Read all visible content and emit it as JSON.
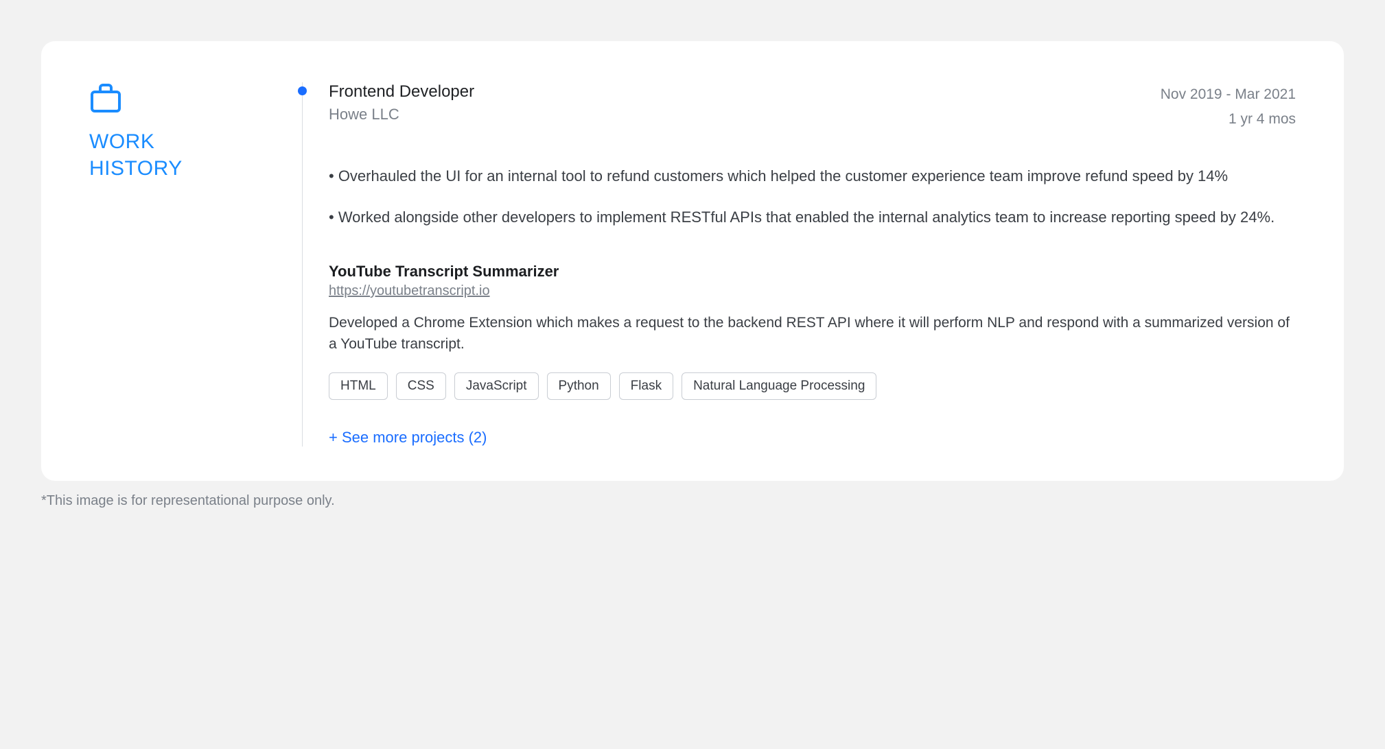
{
  "sidebar": {
    "title_line1": "WORK",
    "title_line2": "HISTORY"
  },
  "job": {
    "title": "Frontend Developer",
    "company": "Howe LLC",
    "date_range": "Nov 2019 - Mar 2021",
    "duration": "1 yr 4 mos",
    "bullets": [
      "• Overhauled the UI for an internal tool to refund customers which helped the customer experience team improve refund speed by 14%",
      "• Worked alongside other developers to implement RESTful APIs that enabled the internal analytics team to increase reporting speed by 24%."
    ]
  },
  "project": {
    "title": "YouTube Transcript Summarizer",
    "url": "https://youtubetranscript.io",
    "description": "Developed a Chrome Extension which makes a request to the backend REST API where it will perform NLP and respond with a summarized version of a YouTube transcript.",
    "tags": [
      "HTML",
      "CSS",
      "JavaScript",
      "Python",
      "Flask",
      "Natural Language Processing"
    ]
  },
  "see_more": "+ See more projects (2)",
  "disclaimer": "*This image is for representational purpose only."
}
